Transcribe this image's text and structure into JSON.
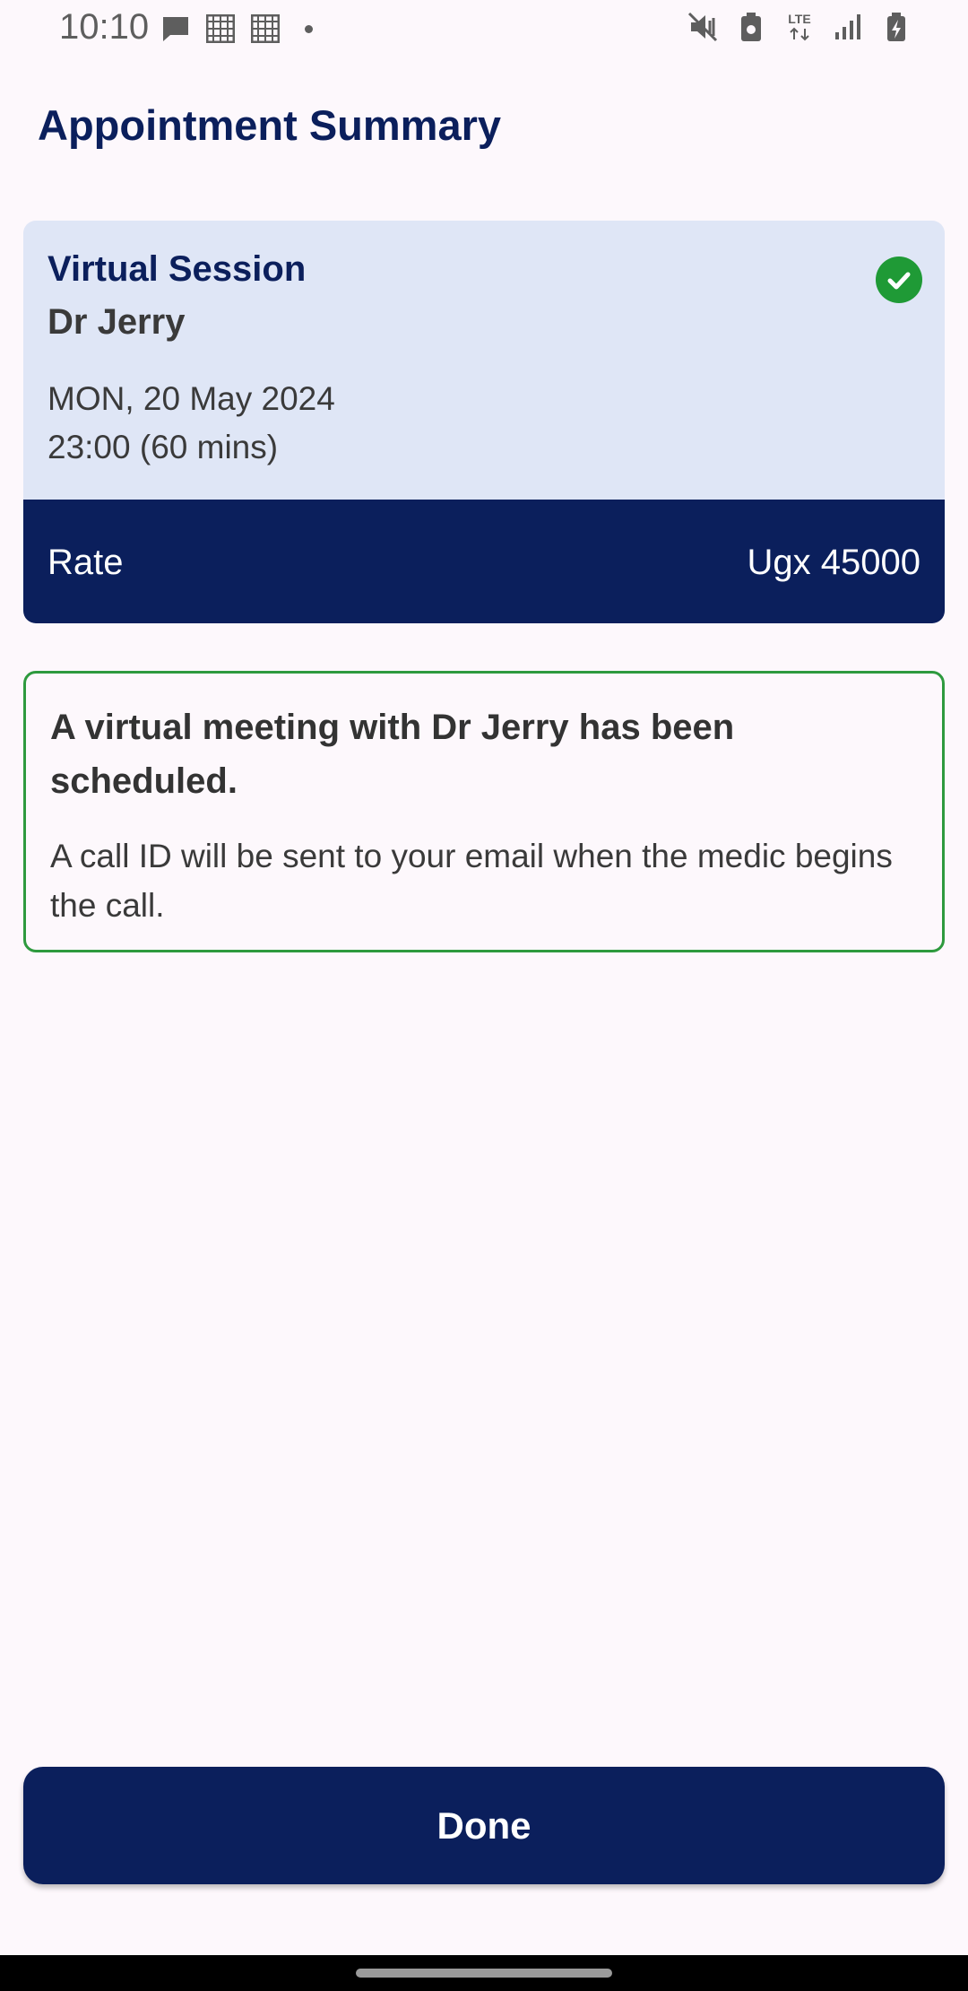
{
  "status_bar": {
    "time": "10:10",
    "left_icons": [
      "message-icon",
      "grid-icon",
      "grid-icon",
      "dot-icon"
    ],
    "right_icons": [
      "mute-icon",
      "battery-saver-icon",
      "lte-icon",
      "signal-icon",
      "battery-icon"
    ],
    "lte_label": "LTE"
  },
  "page": {
    "title": "Appointment Summary"
  },
  "summary_card": {
    "session_type": "Virtual Session",
    "doctor_name": "Dr Jerry",
    "date": "MON, 20 May 2024",
    "time": "23:00 (60 mins)",
    "rate_label": "Rate",
    "rate_value": "Ugx 45000",
    "status_icon": "check-circle-icon"
  },
  "confirmation": {
    "heading": "A virtual meeting with Dr Jerry  has been scheduled.",
    "body": "A call ID will be sent to your email when the medic begins the call."
  },
  "actions": {
    "done_label": "Done"
  },
  "colors": {
    "primary": "#0b1f5c",
    "card_background": "#dfe6f6",
    "success": "#1f9a36",
    "page_background": "#fdf8fc"
  }
}
